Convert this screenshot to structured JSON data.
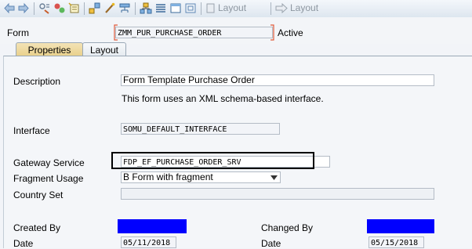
{
  "toolbar": {
    "icons": [
      "back-arrow-icon",
      "forward-arrow-icon",
      "display-change-icon",
      "activate-icon",
      "object-list-icon",
      "hierarchy-icon",
      "edit-wand-icon",
      "where-used-icon",
      "layout-tree-icon",
      "layout-list-icon",
      "window-icon",
      "frame-icon"
    ],
    "layout_label_1": "Layout",
    "layout_label_2": "Layout"
  },
  "header": {
    "form_label": "Form",
    "form_name": "ZMM_PUR_PURCHASE_ORDER",
    "status": "Active"
  },
  "tabs": [
    {
      "label": "Properties",
      "active": true
    },
    {
      "label": "Layout",
      "active": false
    }
  ],
  "properties": {
    "description_label": "Description",
    "description_value": "Form Template Purchase Order",
    "schema_note": "This form uses an XML schema-based interface.",
    "interface_label": "Interface",
    "interface_value": "SOMU_DEFAULT_INTERFACE",
    "gateway_label": "Gateway Service",
    "gateway_value": "FDP_EF_PURCHASE_ORDER_SRV",
    "fragment_label": "Fragment Usage",
    "fragment_value": "B Form with fragment",
    "country_label": "Country Set",
    "country_value": "",
    "created_by_label": "Created By",
    "changed_by_label": "Changed By",
    "date_label_1": "Date",
    "date_value_1": "05/11/2018",
    "date_label_2": "Date",
    "date_value_2": "05/15/2018"
  },
  "colors": {
    "redacted": "#0000ff",
    "active_tab": "#edd9a0",
    "required_bracket": "#e05a3a"
  }
}
